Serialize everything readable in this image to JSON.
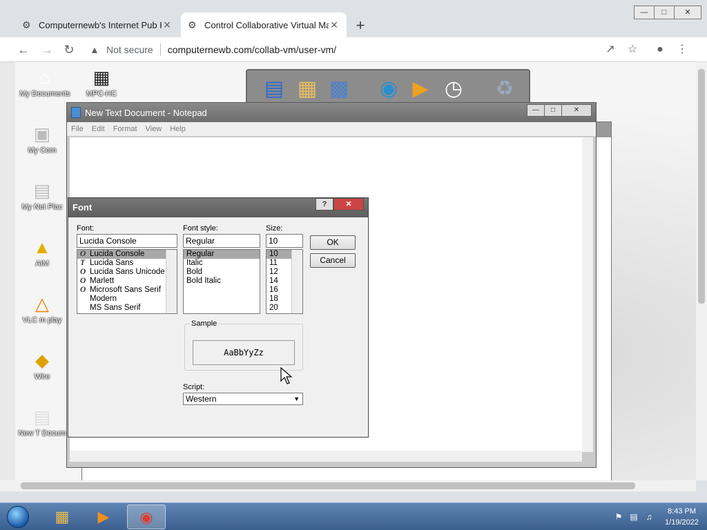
{
  "browser": {
    "tabs": [
      {
        "label": "Computernewb's Internet Pub Hu",
        "active": false
      },
      {
        "label": "Control Collaborative Virtual Mac",
        "active": true
      }
    ],
    "address": {
      "security": "Not secure",
      "url": "computernewb.com/collab-vm/user-vm/"
    }
  },
  "vm_desktop": {
    "icons": [
      "My Documents",
      "MPC-HC",
      "My Com",
      "My Net Plac",
      "AIM",
      "VLC m play",
      "Wire",
      "New T Docum"
    ]
  },
  "notepad": {
    "title": "New Text Document - Notepad",
    "menu": [
      "File",
      "Edit",
      "Format",
      "View",
      "Help"
    ]
  },
  "font_dialog": {
    "title": "Font",
    "font_label": "Font:",
    "font_value": "Lucida Console",
    "fonts": [
      "Lucida Console",
      "Lucida Sans",
      "Lucida Sans Unicode",
      "Marlett",
      "Microsoft Sans Serif",
      "Modern",
      "MS Sans Serif"
    ],
    "style_label": "Font style:",
    "style_value": "Regular",
    "styles": [
      "Regular",
      "Italic",
      "Bold",
      "Bold Italic"
    ],
    "size_label": "Size:",
    "size_value": "10",
    "sizes": [
      "10",
      "11",
      "12",
      "14",
      "16",
      "18",
      "20"
    ],
    "ok_label": "OK",
    "cancel_label": "Cancel",
    "sample_label": "Sample",
    "sample_text": "AaBbYyZz",
    "script_label": "Script:",
    "script_value": "Western"
  },
  "taskbar": {
    "time": "8:43 PM",
    "date": "1/19/2022"
  }
}
